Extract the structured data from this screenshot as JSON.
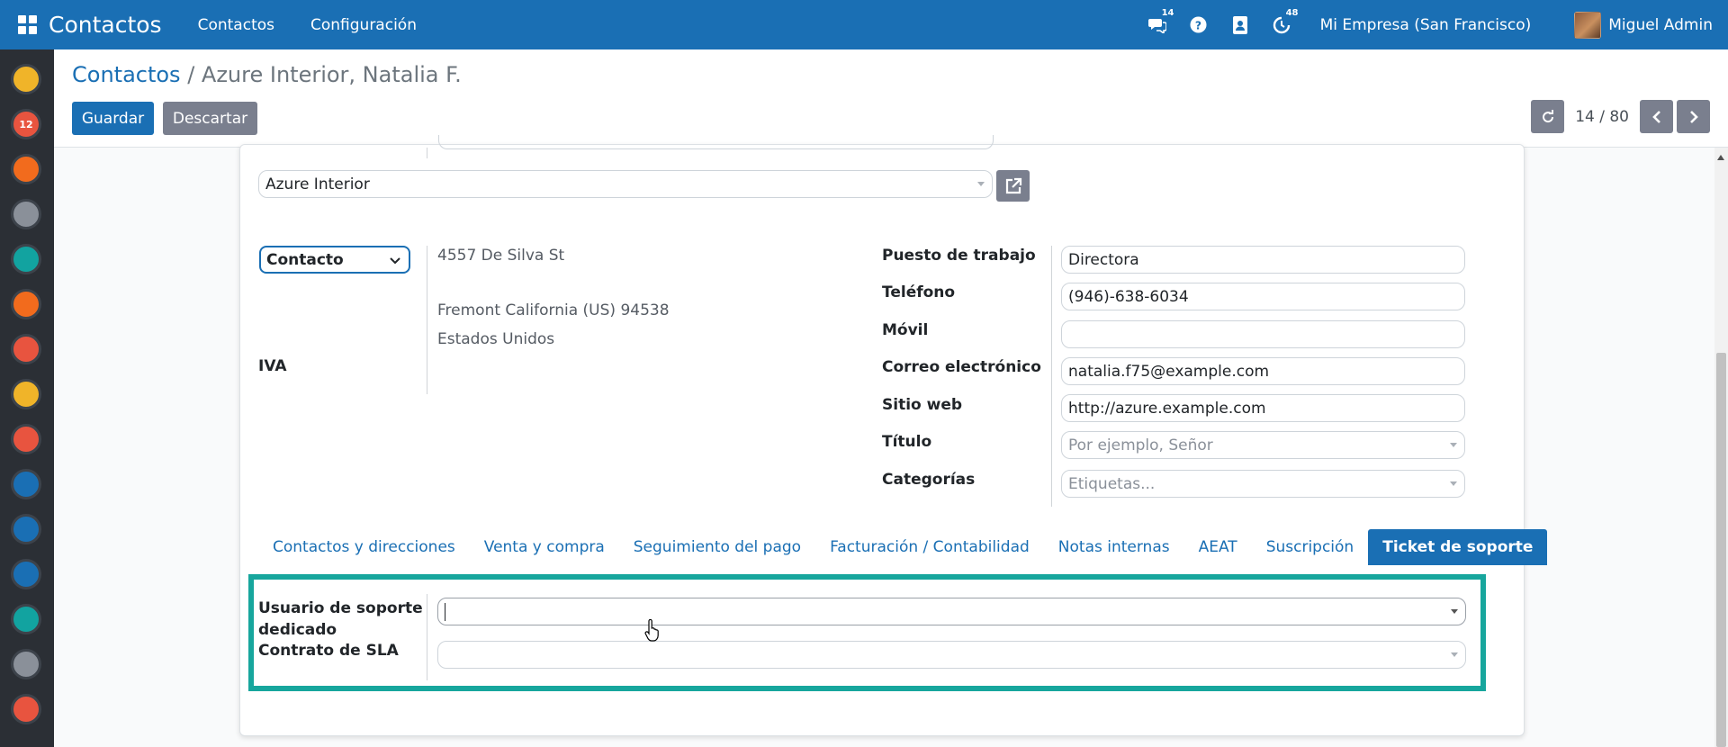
{
  "topbar": {
    "app_title": "Contactos",
    "menu": [
      "Contactos",
      "Configuración"
    ],
    "messages_badge": "14",
    "activity_badge": "48",
    "company": "Mi Empresa (San Francisco)",
    "user": "Miguel Admin"
  },
  "sidebar": {
    "apps": [
      {
        "name": "discuss-app-icon",
        "color": "#f0b429"
      },
      {
        "name": "calendar-app-icon",
        "color": "#e8543f",
        "text": "12"
      },
      {
        "name": "notes-app-icon",
        "color": "#f26b1d"
      },
      {
        "name": "crm-app-icon",
        "color": "#8a9099"
      },
      {
        "name": "employees-app-icon",
        "color": "#12a3a0"
      },
      {
        "name": "sales-app-icon",
        "color": "#f26b1d"
      },
      {
        "name": "reporting-app-icon",
        "color": "#e8543f"
      },
      {
        "name": "elearning-app-icon",
        "color": "#f0b429"
      },
      {
        "name": "marketing-app-icon",
        "color": "#e8543f"
      },
      {
        "name": "pos-app-icon",
        "color": "#1a6fb4"
      },
      {
        "name": "accounting-app-icon",
        "color": "#1a6fb4"
      },
      {
        "name": "planning-app-icon",
        "color": "#1a6fb4"
      },
      {
        "name": "timesheet-app-icon",
        "color": "#12a3a0"
      },
      {
        "name": "shop-app-icon",
        "color": "#8a9099"
      },
      {
        "name": "events-app-icon",
        "color": "#e8543f"
      }
    ]
  },
  "control": {
    "breadcrumb_root": "Contactos",
    "breadcrumb_sep": " / ",
    "breadcrumb_current": "Azure Interior, Natalia F.",
    "save_label": "Guardar",
    "discard_label": "Descartar",
    "pager_value": "14 / 80"
  },
  "form": {
    "company_value": "Azure Interior",
    "address_type": "Contacto",
    "street": "4557 De Silva St",
    "city_line": "Fremont  California (US)  94538",
    "country": "Estados Unidos",
    "vat_label": "IVA",
    "fields": [
      {
        "label": "Puesto de trabajo",
        "value": "Directora",
        "placeholder": ""
      },
      {
        "label": "Teléfono",
        "value": "(946)-638-6034",
        "placeholder": ""
      },
      {
        "label": "Móvil",
        "value": "",
        "placeholder": ""
      },
      {
        "label": "Correo electrónico",
        "value": "natalia.f75@example.com",
        "placeholder": ""
      },
      {
        "label": "Sitio web",
        "value": "http://azure.example.com",
        "placeholder": ""
      },
      {
        "label": "Título",
        "value": "",
        "placeholder": "Por ejemplo, Señor"
      },
      {
        "label": "Categorías",
        "value": "",
        "placeholder": "Etiquetas..."
      }
    ]
  },
  "tabs": [
    {
      "label": "Contactos y direcciones",
      "active": false
    },
    {
      "label": "Venta y compra",
      "active": false
    },
    {
      "label": "Seguimiento del pago",
      "active": false
    },
    {
      "label": "Facturación / Contabilidad",
      "active": false
    },
    {
      "label": "Notas internas",
      "active": false
    },
    {
      "label": "AEAT",
      "active": false
    },
    {
      "label": "Suscripción",
      "active": false
    },
    {
      "label": "Ticket de soporte",
      "active": true
    }
  ],
  "support": {
    "user_label_line1": "Usuario de soporte",
    "user_label_line2": "dedicado",
    "sla_label": "Contrato de SLA",
    "user_value": "",
    "sla_value": ""
  },
  "colors": {
    "primary": "#1a6fb4",
    "secondary_button": "#7a7f8e",
    "highlight": "#17a69d",
    "sidebar_bg": "#2b2f35"
  }
}
